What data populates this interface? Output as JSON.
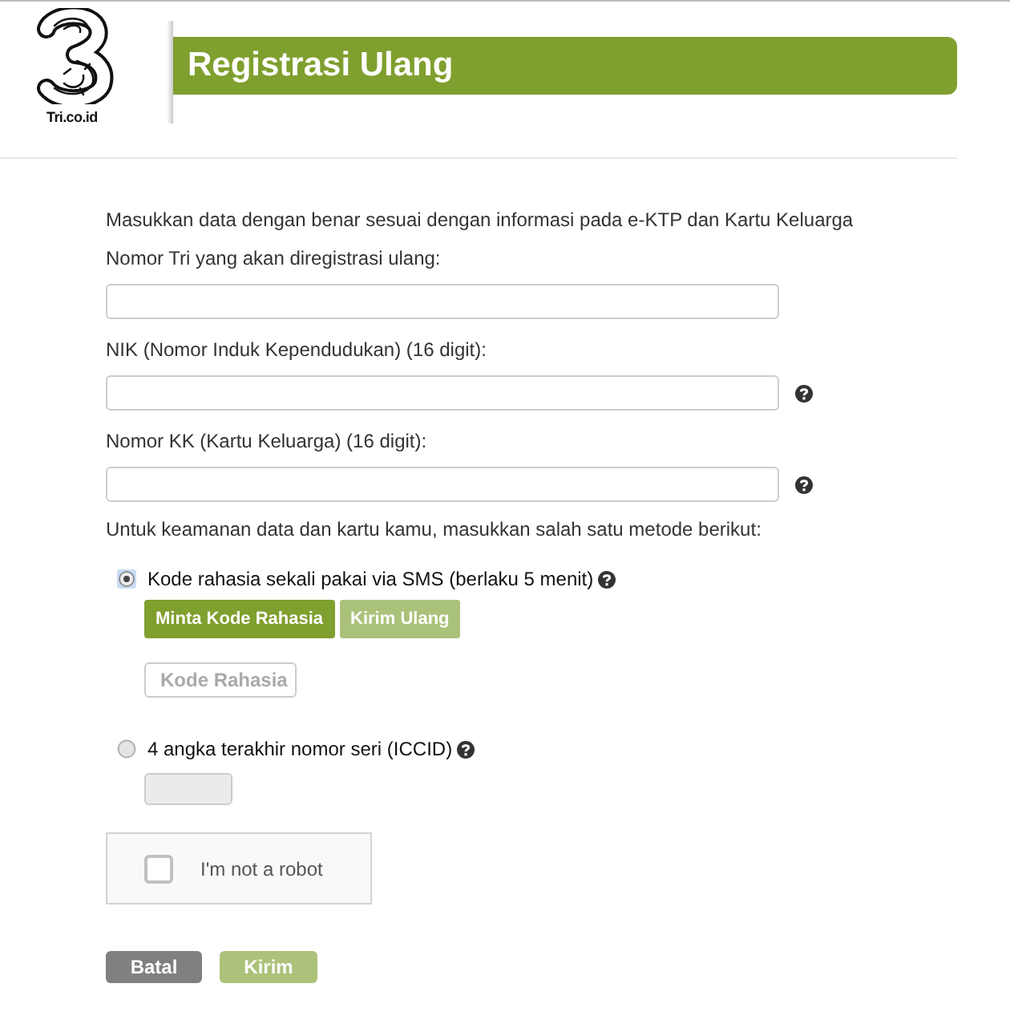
{
  "header": {
    "logo_text": "Tri.co.id",
    "title": "Registrasi Ulang"
  },
  "form": {
    "intro": "Masukkan data dengan benar sesuai dengan informasi pada e-KTP dan Kartu Keluarga",
    "fields": [
      {
        "label": "Nomor Tri yang akan diregistrasi ulang:",
        "help": false
      },
      {
        "label": "NIK (Nomor Induk Kependudukan) (16 digit):",
        "help": true
      },
      {
        "label": "Nomor KK (Kartu Keluarga) (16 digit):",
        "help": true
      }
    ],
    "security_prompt": "Untuk keamanan data dan kartu kamu, masukkan salah satu metode berikut:",
    "methods": [
      {
        "kind": "sms",
        "label": "Kode rahasia sekali pakai via SMS (berlaku 5 menit)",
        "selected": true,
        "help": true,
        "buttons": [
          {
            "label": "Minta Kode Rahasia",
            "disabled": false
          },
          {
            "label": "Kirim Ulang",
            "disabled": true
          }
        ],
        "code_field": {
          "placeholder": "Kode Rahasia"
        }
      },
      {
        "kind": "iccid",
        "label": "4 angka terakhir nomor seri (ICCID)",
        "selected": false,
        "help": true,
        "input": {
          "disabled": true
        }
      }
    ],
    "captcha": {
      "label": "I'm not a robot",
      "checked": false
    },
    "actions": [
      {
        "kind": "cancel",
        "label": "Batal",
        "disabled": false
      },
      {
        "kind": "submit",
        "label": "Kirim",
        "disabled": true
      }
    ]
  }
}
